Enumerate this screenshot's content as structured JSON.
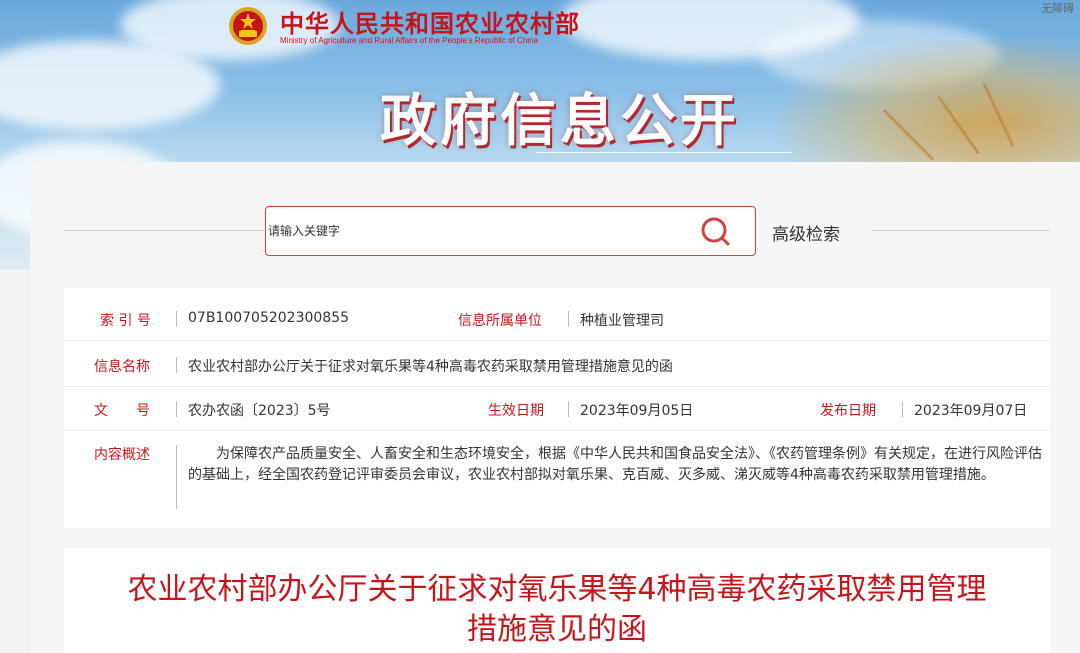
{
  "header": {
    "ministry_name_cn": "中华人民共和国农业农村部",
    "ministry_name_en": "Ministry of Agriculture and Rural Affairs of the People's Republic of China",
    "accessibility_link": "无障碍",
    "hero_title": "政府信息公开"
  },
  "search": {
    "placeholder": "请输入关键字",
    "advanced_label": "高级检索",
    "icon": "search-icon"
  },
  "info": {
    "index_label": "索 引 号",
    "index_value": "07B100705202300855",
    "unit_label": "信息所属单位",
    "unit_value": "种植业管理司",
    "name_label": "信息名称",
    "name_value": "农业农村部办公厅关于征求对氧乐果等4种高毒农药采取禁用管理措施意见的函",
    "doc_no_label": "文　　号",
    "doc_no_value": "农办农函〔2023〕5号",
    "effective_label": "生效日期",
    "effective_value": "2023年09月05日",
    "publish_label": "发布日期",
    "publish_value": "2023年09月07日",
    "summary_label": "内容概述",
    "summary_value": "为保障农产品质量安全、人畜安全和生态环境安全，根据《中华人民共和国食品安全法》、《农药管理条例》有关规定，在进行风险评估的基础上，经全国农药登记评审委员会审议，农业农村部拟对氧乐果、克百威、灭多威、涕灭威等4种高毒农药采取禁用管理措施。"
  },
  "article": {
    "title_line1": "农业农村部办公厅关于征求对氧乐果等4种高毒农药采取禁用管理",
    "title_line2": "措施意见的函"
  },
  "colors": {
    "accent_red": "#c3161c",
    "text": "#333333",
    "panel_bg": "#f5f5f5"
  }
}
